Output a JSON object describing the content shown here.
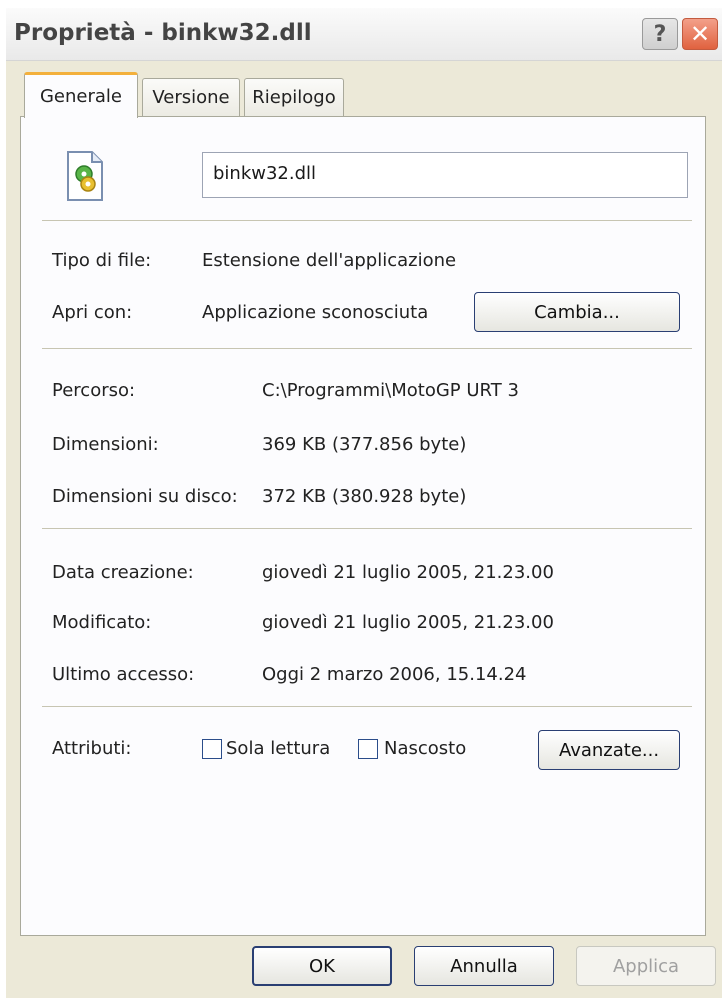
{
  "dialog": {
    "title": "Proprietà - binkw32.dll",
    "help_glyph": "?",
    "close_glyph": "✕"
  },
  "tabs": [
    {
      "label": "Generale",
      "active": true
    },
    {
      "label": "Versione",
      "active": false
    },
    {
      "label": "Riepilogo",
      "active": false
    }
  ],
  "general": {
    "file_name": "binkw32.dll",
    "icon": "dll-file-icon",
    "file_type_label": "Tipo di file:",
    "file_type_value": "Estensione dell'applicazione",
    "open_with_label": "Apri con:",
    "open_with_value": "Applicazione sconosciuta",
    "change_button": "Cambia...",
    "path_label": "Percorso:",
    "path_value": "C:\\Programmi\\MotoGP URT 3",
    "size_label": "Dimensioni:",
    "size_value": "369 KB (377.856 byte)",
    "disk_size_label": "Dimensioni su disco:",
    "disk_size_value": "372 KB (380.928 byte)",
    "created_label": "Data creazione:",
    "created_value": "giovedì 21 luglio 2005, 21.23.00",
    "modified_label": "Modificato:",
    "modified_value": "giovedì 21 luglio 2005, 21.23.00",
    "accessed_label": "Ultimo accesso:",
    "accessed_value": "Oggi 2 marzo 2006, 15.14.24",
    "attributes_label": "Attributi:",
    "readonly_label": "Sola lettura",
    "readonly_checked": false,
    "hidden_label": "Nascosto",
    "hidden_checked": false,
    "advanced_button": "Avanzate..."
  },
  "footer": {
    "ok": "OK",
    "cancel": "Annulla",
    "apply": "Applica"
  },
  "colors": {
    "tab_highlight": "#f3b03c",
    "dialog_background": "#ece9d8",
    "close_button": "#e0623f"
  }
}
